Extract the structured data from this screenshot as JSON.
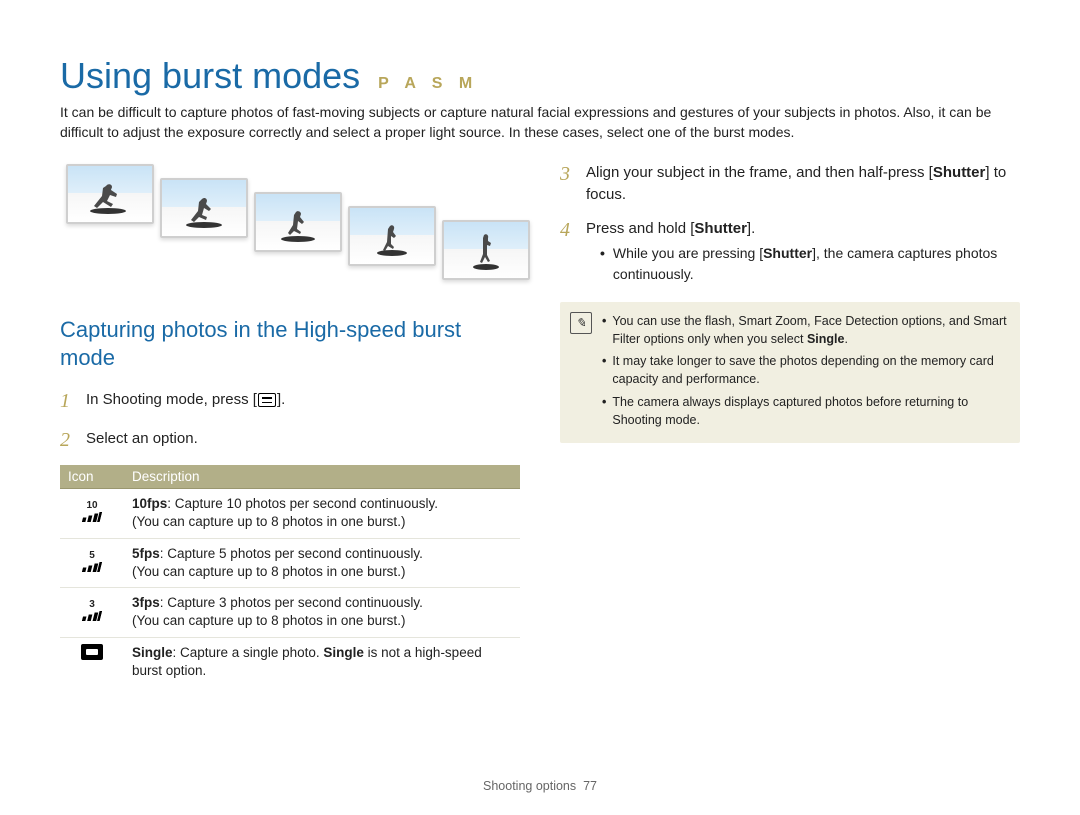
{
  "title": "Using burst modes",
  "mode_letters": "P A S M",
  "intro": "It can be difficult to capture photos of fast-moving subjects or capture natural facial expressions and gestures of your subjects in photos. Also, it can be difficult to adjust the exposure correctly and select a proper light source. In these cases, select one of the burst modes.",
  "subheading": "Capturing photos in the High-speed burst mode",
  "steps_left": {
    "s1": {
      "num": "1",
      "pre": "In Shooting mode, press [",
      "post": "]."
    },
    "s2": {
      "num": "2",
      "text": "Select an option."
    }
  },
  "table": {
    "headers": {
      "icon": "Icon",
      "desc": "Description"
    },
    "rows": [
      {
        "label": "10",
        "bold": "10fps",
        "rest": ": Capture 10 photos per second continuously.",
        "note": "(You can capture up to 8 photos in one burst.)"
      },
      {
        "label": "5",
        "bold": "5fps",
        "rest": ": Capture 5 photos per second continuously.",
        "note": "(You can capture up to 8 photos in one burst.)"
      },
      {
        "label": "3",
        "bold": "3fps",
        "rest": ": Capture 3 photos per second continuously.",
        "note": "(You can capture up to 8 photos in one burst.)"
      },
      {
        "label": "single",
        "bold": "Single",
        "rest": ": Capture a single photo. ",
        "bold2": "Single",
        "rest2": " is not a high-speed burst option."
      }
    ]
  },
  "steps_right": {
    "s3": {
      "num": "3",
      "pre": "Align your subject in the frame, and then half-press [",
      "bold": "Shutter",
      "post": "] to focus."
    },
    "s4": {
      "num": "4",
      "pre": "Press and hold [",
      "bold": "Shutter",
      "post": "]."
    },
    "s4_bullet": {
      "pre": "While you are pressing [",
      "bold": "Shutter",
      "post": "], the camera captures photos continuously."
    }
  },
  "note_items": [
    {
      "pre": "You can use the flash, Smart Zoom, Face Detection options, and Smart Filter options only when you select ",
      "bold": "Single",
      "post": "."
    },
    {
      "text": "It may take longer to save the photos depending on the memory card capacity and performance."
    },
    {
      "text": "The camera always displays captured photos before returning to Shooting mode."
    }
  ],
  "footer": {
    "section": "Shooting options",
    "page": "77"
  }
}
